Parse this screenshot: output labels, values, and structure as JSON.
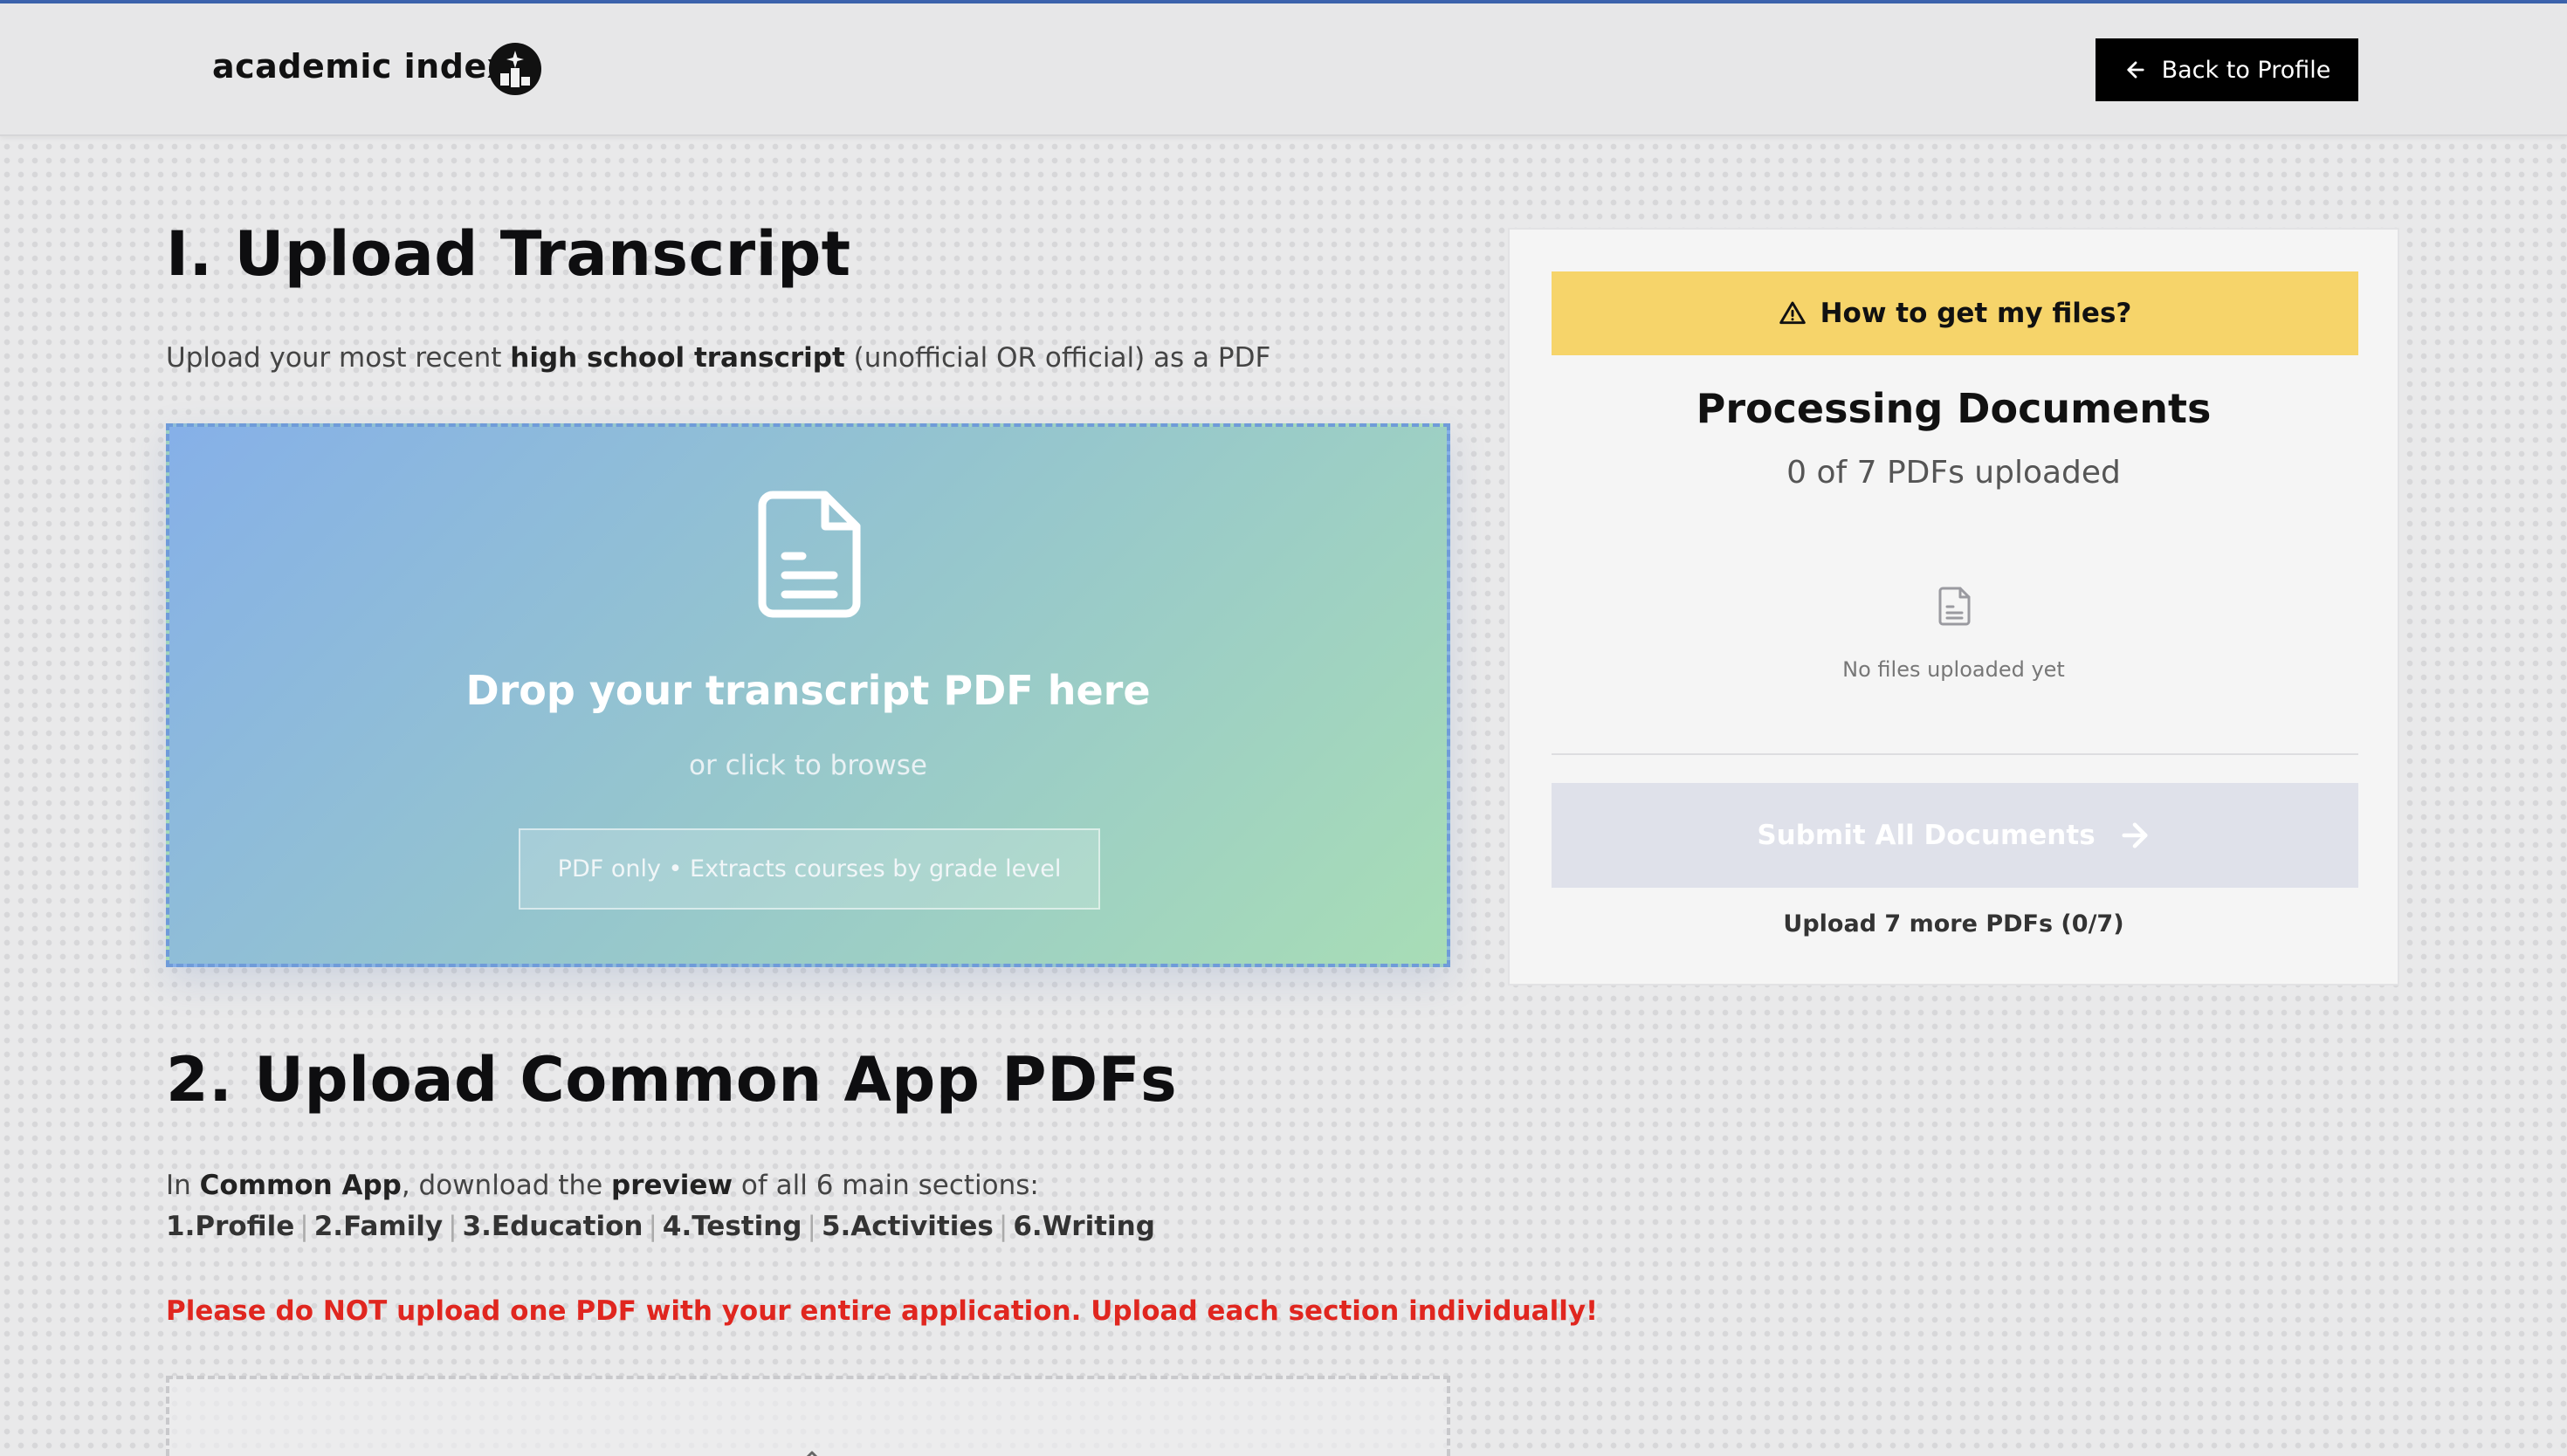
{
  "header": {
    "logo_text": "academic index",
    "back_button_label": "Back to Profile"
  },
  "section1": {
    "title": "I. Upload Transcript",
    "desc_prefix": "Upload your most recent ",
    "desc_bold": "high school transcript",
    "desc_suffix": " (unofficial OR official) as a PDF",
    "dropzone": {
      "title": "Drop your transcript PDF here",
      "subtitle": "or click to browse",
      "badge": "PDF only • Extracts courses by grade level"
    }
  },
  "panel": {
    "howto_label": "How to get my files?",
    "title": "Processing Documents",
    "count_text": "0 of 7 PDFs uploaded",
    "empty_text": "No files uploaded yet",
    "submit_label": "Submit All Documents",
    "upload_more_text": "Upload 7 more PDFs (0/7)"
  },
  "section2": {
    "title": "2. Upload Common App PDFs",
    "desc_in": "In ",
    "desc_app": "Common App",
    "desc_mid": ", download the ",
    "desc_preview": "preview",
    "desc_end": " of all 6 main sections:",
    "sections": [
      "1.Profile",
      "2.Family",
      "3.Education",
      "4.Testing",
      "5.Activities",
      "6.Writing"
    ],
    "warning": "Please do NOT upload one PDF with your entire application. Upload each section individually!"
  },
  "colors": {
    "accent_line": "#3c63ad",
    "howto_bg": "#f6d46a",
    "warning": "#e0261f"
  }
}
